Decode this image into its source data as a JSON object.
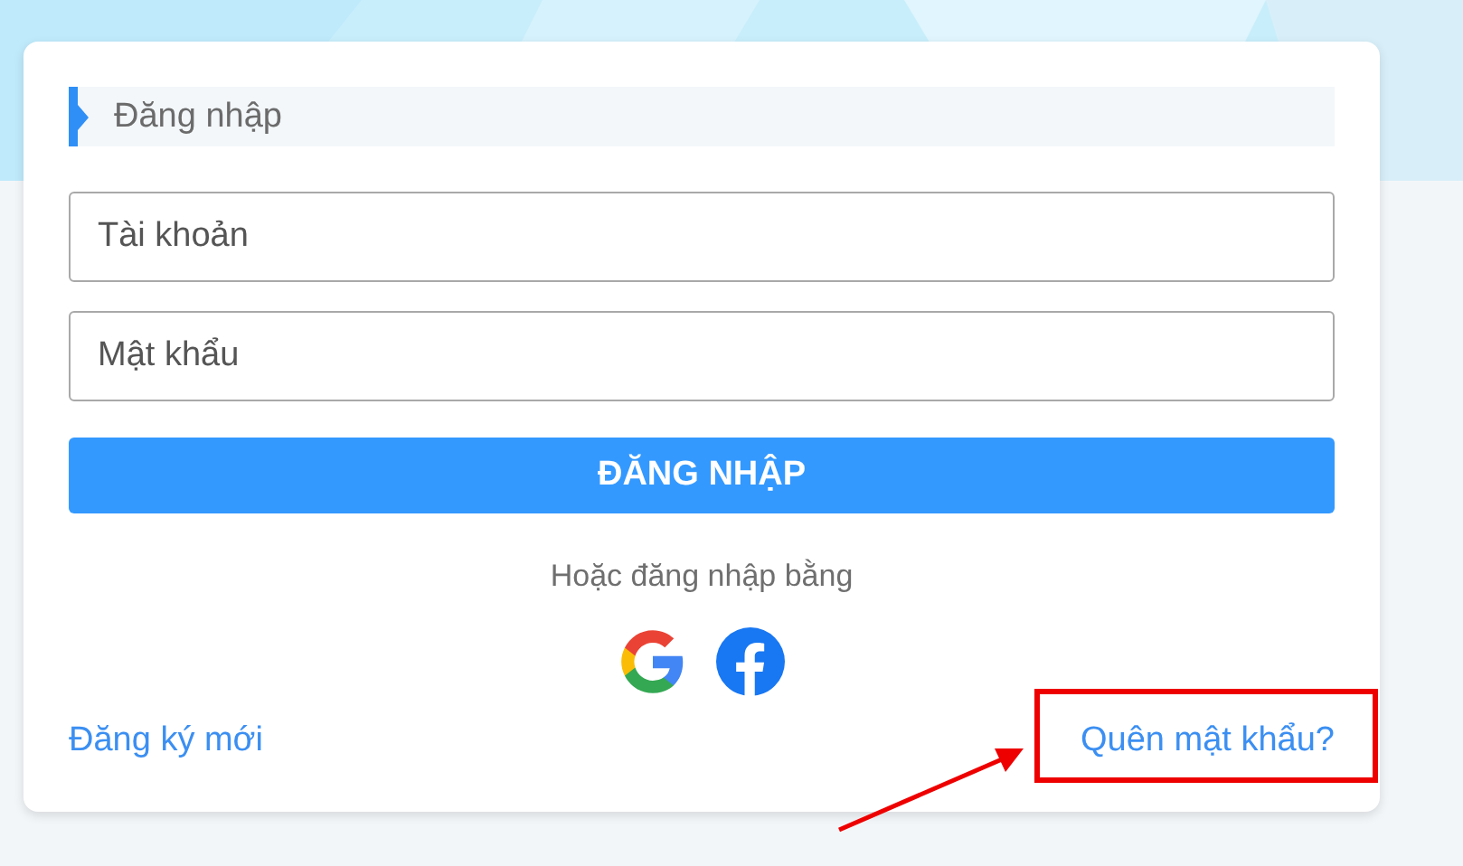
{
  "title": "Đăng nhập",
  "fields": [
    {
      "placeholder": "Tài khoản"
    },
    {
      "placeholder": "Mật khẩu"
    }
  ],
  "submit": "ĐĂNG NHẬP",
  "alt_login": "Hoặc đăng nhập bằng",
  "register_link": "Đăng ký mới",
  "forgot_link": "Quên mật khẩu?"
}
